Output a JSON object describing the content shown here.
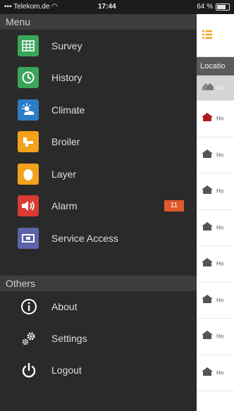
{
  "status_bar": {
    "carrier": "Telekom.de",
    "time": "17:44",
    "battery": "64 %"
  },
  "drawer": {
    "menu_header": "Menu",
    "items": [
      {
        "label": "Survey",
        "icon": "grid-icon",
        "color": "#3aa55a"
      },
      {
        "label": "History",
        "icon": "clock-icon",
        "color": "#3aa55a"
      },
      {
        "label": "Climate",
        "icon": "sun-cloud-icon",
        "color": "#2c7cc6"
      },
      {
        "label": "Broiler",
        "icon": "broiler-icon",
        "color": "#f2a21b"
      },
      {
        "label": "Layer",
        "icon": "egg-icon",
        "color": "#f2a21b"
      },
      {
        "label": "Alarm",
        "icon": "speaker-icon",
        "color": "#d83b33",
        "badge": "11"
      },
      {
        "label": "Service Access",
        "icon": "service-card-icon",
        "color": "#5d63a8"
      }
    ],
    "others_header": "Others",
    "others": [
      {
        "label": "About",
        "icon": "info-icon"
      },
      {
        "label": "Settings",
        "icon": "gears-icon"
      },
      {
        "label": "Logout",
        "icon": "power-icon"
      }
    ]
  },
  "panel": {
    "subheader": "Locatio",
    "rows": [
      {
        "label": "Do",
        "selected": true
      },
      {
        "label": "Ho",
        "alert": true
      },
      {
        "label": "Ho"
      },
      {
        "label": "Ho"
      },
      {
        "label": "Ho"
      },
      {
        "label": "Ho"
      },
      {
        "label": "Ho"
      },
      {
        "label": "Ho"
      },
      {
        "label": "Ho"
      }
    ]
  },
  "colors": {
    "badge": "#e05a2b",
    "drawer_bg": "#2a2a2a",
    "section_header_bg": "#3d3d3d",
    "alert_house": "#b01c1c"
  }
}
